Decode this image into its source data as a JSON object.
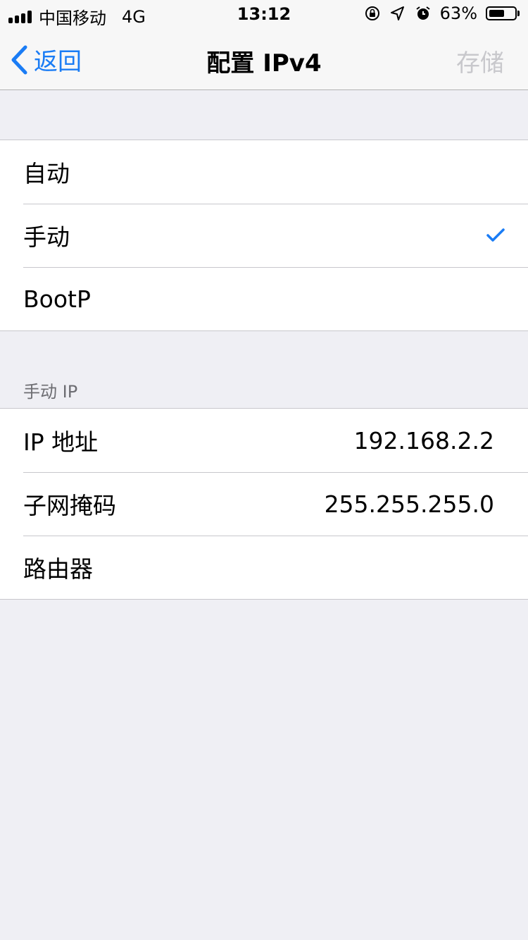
{
  "status_bar": {
    "carrier": "中国移动",
    "network": "4G",
    "time": "13:12",
    "battery_percent": "63%",
    "battery_level": 0.63,
    "icons": [
      "signal-icon",
      "rotation-lock-icon",
      "location-icon",
      "alarm-icon",
      "battery-icon"
    ]
  },
  "nav": {
    "back_label": "返回",
    "title": "配置 IPv4",
    "save_label": "存储"
  },
  "config_options": [
    {
      "label": "自动",
      "selected": false
    },
    {
      "label": "手动",
      "selected": true
    },
    {
      "label": "BootP",
      "selected": false
    }
  ],
  "manual_ip": {
    "section_title": "手动 IP",
    "rows": [
      {
        "label": "IP 地址",
        "value": "192.168.2.2"
      },
      {
        "label": "子网掩码",
        "value": "255.255.255.0"
      },
      {
        "label": "路由器",
        "value": ""
      }
    ]
  },
  "colors": {
    "accent": "#1a7cf5",
    "background": "#efeff4",
    "disabled": "#c8c8cc"
  }
}
